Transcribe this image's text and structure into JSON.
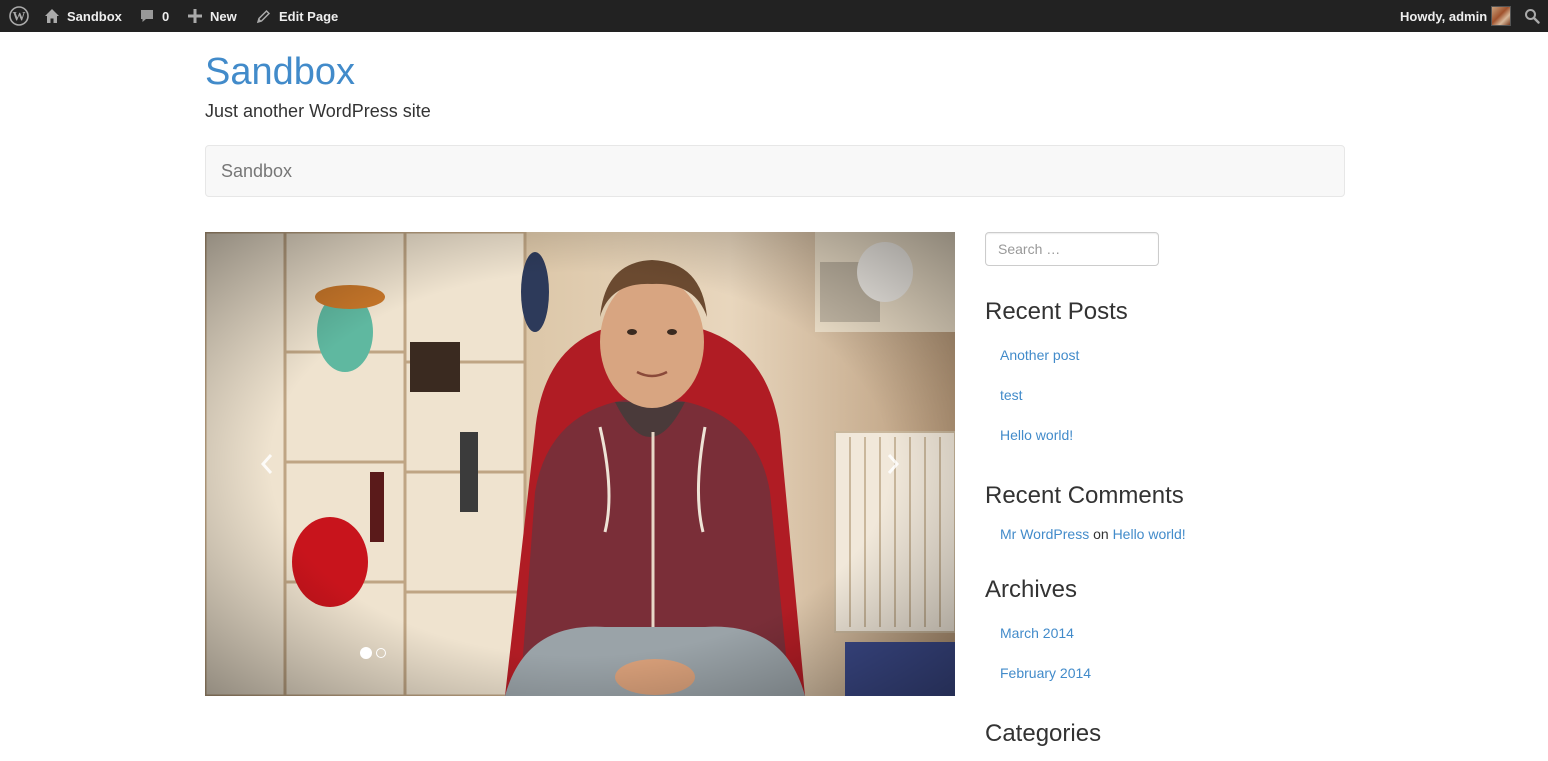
{
  "adminbar": {
    "site_name": "Sandbox",
    "comments_count": "0",
    "new_label": "New",
    "edit_label": "Edit Page",
    "account_label": "Howdy, admin",
    "icons": [
      "wordpress-icon",
      "home-icon",
      "comment-icon",
      "plus-icon",
      "pencil-icon",
      "avatar",
      "search-icon"
    ]
  },
  "header": {
    "site_title": "Sandbox",
    "site_description": "Just another WordPress site"
  },
  "navbar": {
    "brand": "Sandbox"
  },
  "carousel": {
    "slide_count": 2,
    "active_index": 0
  },
  "sidebar": {
    "search": {
      "placeholder": "Search …"
    },
    "recent_posts": {
      "title": "Recent Posts",
      "items": [
        "Another post",
        "test",
        "Hello world!"
      ]
    },
    "recent_comments": {
      "title": "Recent Comments",
      "author": "Mr WordPress",
      "connector": "on",
      "post": "Hello world!"
    },
    "archives": {
      "title": "Archives",
      "items": [
        "March 2014",
        "February 2014"
      ]
    },
    "categories": {
      "title": "Categories"
    }
  },
  "colors": {
    "adminbar_bg": "#222222",
    "link": "#428bca",
    "navbar_bg": "#f8f8f8"
  }
}
